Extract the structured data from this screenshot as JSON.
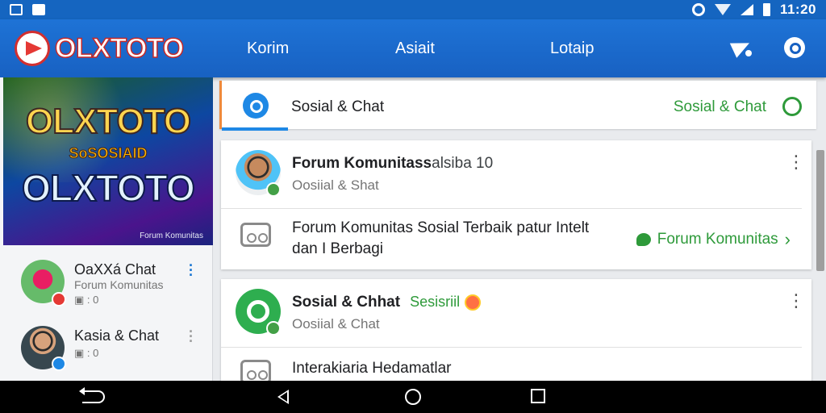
{
  "status_bar": {
    "time": "11:20"
  },
  "app_bar": {
    "brand": "OLXTOTO",
    "nav": [
      "Korim",
      "Asiait",
      "Lotaip"
    ]
  },
  "sidebar": {
    "banner": {
      "line1": "OLXTOTO",
      "line2": "SoSOSIAID",
      "line3": "OLXTOTO",
      "caption": "Forum Komunitas"
    },
    "items": [
      {
        "title": "OaXXá Chat",
        "subtitle": "Forum Komunitas",
        "meta": "0"
      },
      {
        "title": "Kasia & Chat",
        "subtitle": "",
        "meta": "0"
      }
    ]
  },
  "main": {
    "tab": {
      "label": "Sosial & Chat",
      "right_label": "Sosial & Chat"
    },
    "cards": [
      {
        "title": "Forum Komunitass",
        "title_suffix": "alsiba 10",
        "subtitle": "Oosiial & Shat",
        "body": "Forum Komunitas Sosial Terbaik patur Intelt dan I Berbagi",
        "link_label": "Forum Komunitas"
      },
      {
        "title": "Sosial & Chhat",
        "tag": "Sesisriil",
        "subtitle": "Oosiial & Chat",
        "body": "Interakiaria Hedamatlar"
      }
    ]
  },
  "colors": {
    "primary": "#1861c2",
    "accent_green": "#2e9a3a",
    "brand_red": "#e53935"
  }
}
